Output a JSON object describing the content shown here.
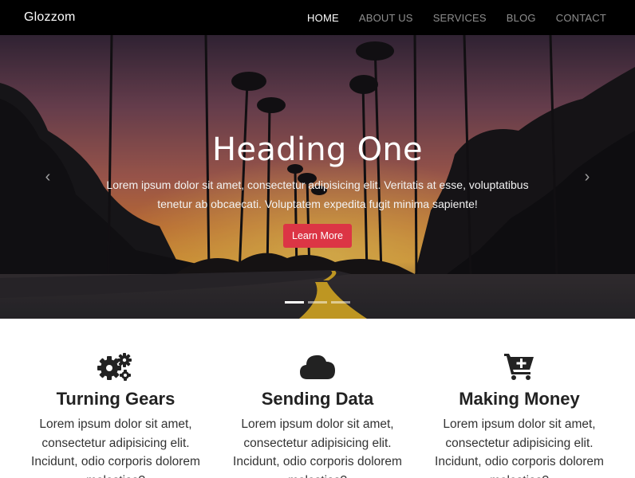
{
  "navbar": {
    "brand": "Glozzom",
    "links": [
      {
        "label": "HOME",
        "active": true
      },
      {
        "label": "ABOUT US",
        "active": false
      },
      {
        "label": "SERVICES",
        "active": false
      },
      {
        "label": "BLOG",
        "active": false
      },
      {
        "label": "CONTACT",
        "active": false
      }
    ]
  },
  "hero": {
    "title": "Heading One",
    "text": "Lorem ipsum dolor sit amet, consectetur adipisicing elit. Veritatis at esse, voluptatibus tenetur ab obcaecati. Voluptatem expedita fugit minima sapiente!",
    "button_label": "Learn More",
    "prev_icon": "chevron-left-icon",
    "next_icon": "chevron-right-icon",
    "slides_count": 3,
    "active_slide": 1
  },
  "features": [
    {
      "icon": "gears-icon",
      "title": "Turning Gears",
      "text": "Lorem ipsum dolor sit amet, consectetur adipisicing elit. Incidunt, odio corporis dolorem molestias?"
    },
    {
      "icon": "cloud-icon",
      "title": "Sending Data",
      "text": "Lorem ipsum dolor sit amet, consectetur adipisicing elit. Incidunt, odio corporis dolorem molestias?"
    },
    {
      "icon": "cart-plus-icon",
      "title": "Making Money",
      "text": "Lorem ipsum dolor sit amet, consectetur adipisicing elit. Incidunt, odio corporis dolorem molestias?"
    }
  ],
  "colors": {
    "navbar_bg": "#000000",
    "button": "#dc3545",
    "icon": "#222222"
  }
}
